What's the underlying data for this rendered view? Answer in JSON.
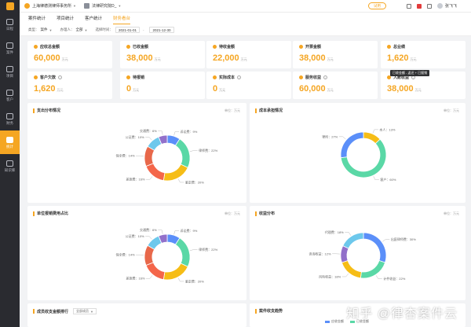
{
  "sidebar": {
    "items": [
      {
        "label": "日程",
        "active": false
      },
      {
        "label": "案件",
        "active": false
      },
      {
        "label": "项目",
        "active": false
      },
      {
        "label": "客户",
        "active": false
      },
      {
        "label": "财务",
        "active": false
      },
      {
        "label": "统计",
        "active": true
      },
      {
        "label": "知识库",
        "active": false
      }
    ]
  },
  "topbar": {
    "org_name": "上海律德测律师事务所",
    "project_name": "法律研究院D_",
    "status_pill": "试用",
    "user_name": "张飞飞"
  },
  "tabs": [
    {
      "label": "案件统计",
      "active": false
    },
    {
      "label": "项目统计",
      "active": false
    },
    {
      "label": "客户统计",
      "active": false
    },
    {
      "label": "财务看台",
      "active": true
    }
  ],
  "filter": {
    "type_label": "类型：",
    "type_value": "案件",
    "owner_label": "办理人：",
    "owner_value": "全部",
    "date_label": "选择时间：",
    "date_start": "2021-01-01",
    "date_sep": "-",
    "date_end": "2021-12-30"
  },
  "stats": [
    {
      "label": "应收总金额",
      "value": "60,000",
      "unit": "万元",
      "info": false
    },
    {
      "label": "已收金额",
      "value": "38,000",
      "unit": "万元",
      "info": false
    },
    {
      "label": "待收金额",
      "value": "22,000",
      "unit": "万元",
      "info": false
    },
    {
      "label": "开票金额",
      "value": "38,000",
      "unit": "万元",
      "info": false
    },
    {
      "label": "总业绩",
      "value": "1,620",
      "unit": "万元",
      "info": false
    },
    {
      "label": "客户欠款",
      "value": "1,620",
      "unit": "万元",
      "info": true
    },
    {
      "label": "待报销",
      "value": "0",
      "unit": "万元",
      "info": false
    },
    {
      "label": "实际成本",
      "value": "0",
      "unit": "万元",
      "info": true
    },
    {
      "label": "服务收益",
      "value": "60,000",
      "unit": "万元",
      "info": true
    },
    {
      "label": "入账收益",
      "value": "38,000",
      "unit": "万元",
      "info": true
    }
  ],
  "tooltip": "已收金额 - 返还 + 已报销",
  "colors": {
    "accent": "#f5a623",
    "sidebar": "#2a2b30"
  },
  "panels": {
    "expense": {
      "title": "支出分布情况",
      "unit": "单位：万元"
    },
    "cost": {
      "title": "成本承担情况",
      "unit": "单位：万元"
    },
    "unit_ratio": {
      "title": "单位报销费用占比",
      "unit": "单位：万元"
    },
    "income": {
      "title": "收益分布",
      "unit": "单位：万元"
    },
    "rank": {
      "title": "成员收支金额排行",
      "select": "全部成员"
    },
    "trend": {
      "title": "案件收支趋势"
    }
  },
  "chart_data": [
    {
      "type": "pie",
      "categories": [
        "诉讼费",
        "律师费",
        "鉴定费",
        "差旅费",
        "保全费",
        "公证费",
        "交通费"
      ],
      "values": [
        9,
        22,
        20,
        16,
        14,
        10,
        6
      ],
      "colors": [
        "#5b8ff9",
        "#5ad8a6",
        "#f6bd16",
        "#f4664a",
        "#e8684a",
        "#6dc8ec",
        "#9270ca"
      ],
      "labels": [
        "诉讼费：9%",
        "律师费：22%",
        "鉴定费：20%",
        "差旅费：16%",
        "保全费：14%",
        "公证费：10%",
        "交通费：6%"
      ]
    },
    {
      "type": "pie",
      "categories": [
        "本人",
        "客户",
        "律所"
      ],
      "values": [
        13,
        60,
        27
      ],
      "colors": [
        "#f6bd16",
        "#5ad8a6",
        "#5b8ff9"
      ],
      "labels": [
        "本人：13%",
        "客户：60%",
        "律所：27%"
      ]
    },
    {
      "type": "pie",
      "categories": [
        "诉讼费",
        "律师费",
        "鉴定费",
        "差旅费",
        "保全费",
        "公证费",
        "交通费"
      ],
      "values": [
        9,
        22,
        20,
        16,
        14,
        10,
        6
      ],
      "colors": [
        "#5b8ff9",
        "#5ad8a6",
        "#f6bd16",
        "#f4664a",
        "#e8684a",
        "#6dc8ec",
        "#9270ca"
      ],
      "labels": [
        "诉讼费：9%",
        "律师费：22%",
        "鉴定费：20%",
        "差旅费：16%",
        "保全费：14%",
        "公证费：10%",
        "交通费：6%"
      ]
    },
    {
      "type": "pie",
      "categories": [
        "出庭律师费",
        "计件收益",
        "风险收益",
        "咨询收益",
        "代理费"
      ],
      "values": [
        30,
        22,
        18,
        12,
        18
      ],
      "colors": [
        "#5b8ff9",
        "#5ad8a6",
        "#f6bd16",
        "#9270ca",
        "#6dc8ec"
      ],
      "labels": [
        "出庭律师费：30%",
        "计件收益：22%",
        "风险收益：18%",
        "咨询收益：12%",
        "代理费：18%"
      ]
    }
  ],
  "trend_legend": [
    "应收金额",
    "已收金额"
  ],
  "watermark": "知乎 @律杏案件云"
}
